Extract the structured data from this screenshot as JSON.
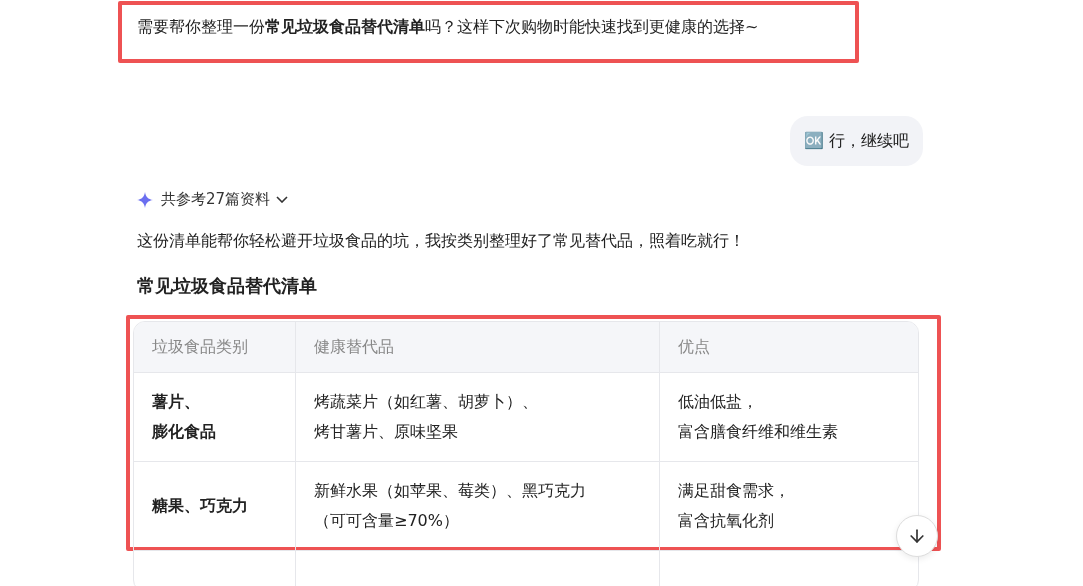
{
  "intro": {
    "text": "需要帮你整理一份**常见垃圾食品替代清单**吗？这样下次购物时能快速找到更健康的选择~",
    "highlighted": true
  },
  "user_message": {
    "text": "🆗 行，继续吧"
  },
  "sources": {
    "label": "共参考27篇资料",
    "expanded": false
  },
  "answer": {
    "paragraph": "这份清单能帮你轻松避开垃圾食品的坑，我按类别整理好了常见替代品，照着吃就行！",
    "heading": "常见垃圾食品替代清单",
    "table": {
      "highlighted": true,
      "columns": [
        "垃圾食品类别",
        "健康替代品",
        "优点"
      ],
      "rows": [
        {
          "cells": [
            {
              "lines": [
                "薯片、",
                "膨化食品"
              ]
            },
            {
              "lines": [
                "烤蔬菜片（如红薯、胡萝卜）、",
                "烤甘薯片、原味坚果"
              ]
            },
            {
              "lines": [
                "低油低盐，",
                "富含膳食纤维和维生素"
              ]
            }
          ]
        },
        {
          "cells": [
            {
              "lines": [
                "糖果、巧克力"
              ]
            },
            {
              "lines": [
                "新鲜水果（如苹果、莓类）、黑巧克力",
                "（可可含量≥70%）"
              ]
            },
            {
              "lines": [
                "满足甜食需求，",
                "富含抗氧化剂"
              ]
            }
          ]
        }
      ]
    }
  }
}
